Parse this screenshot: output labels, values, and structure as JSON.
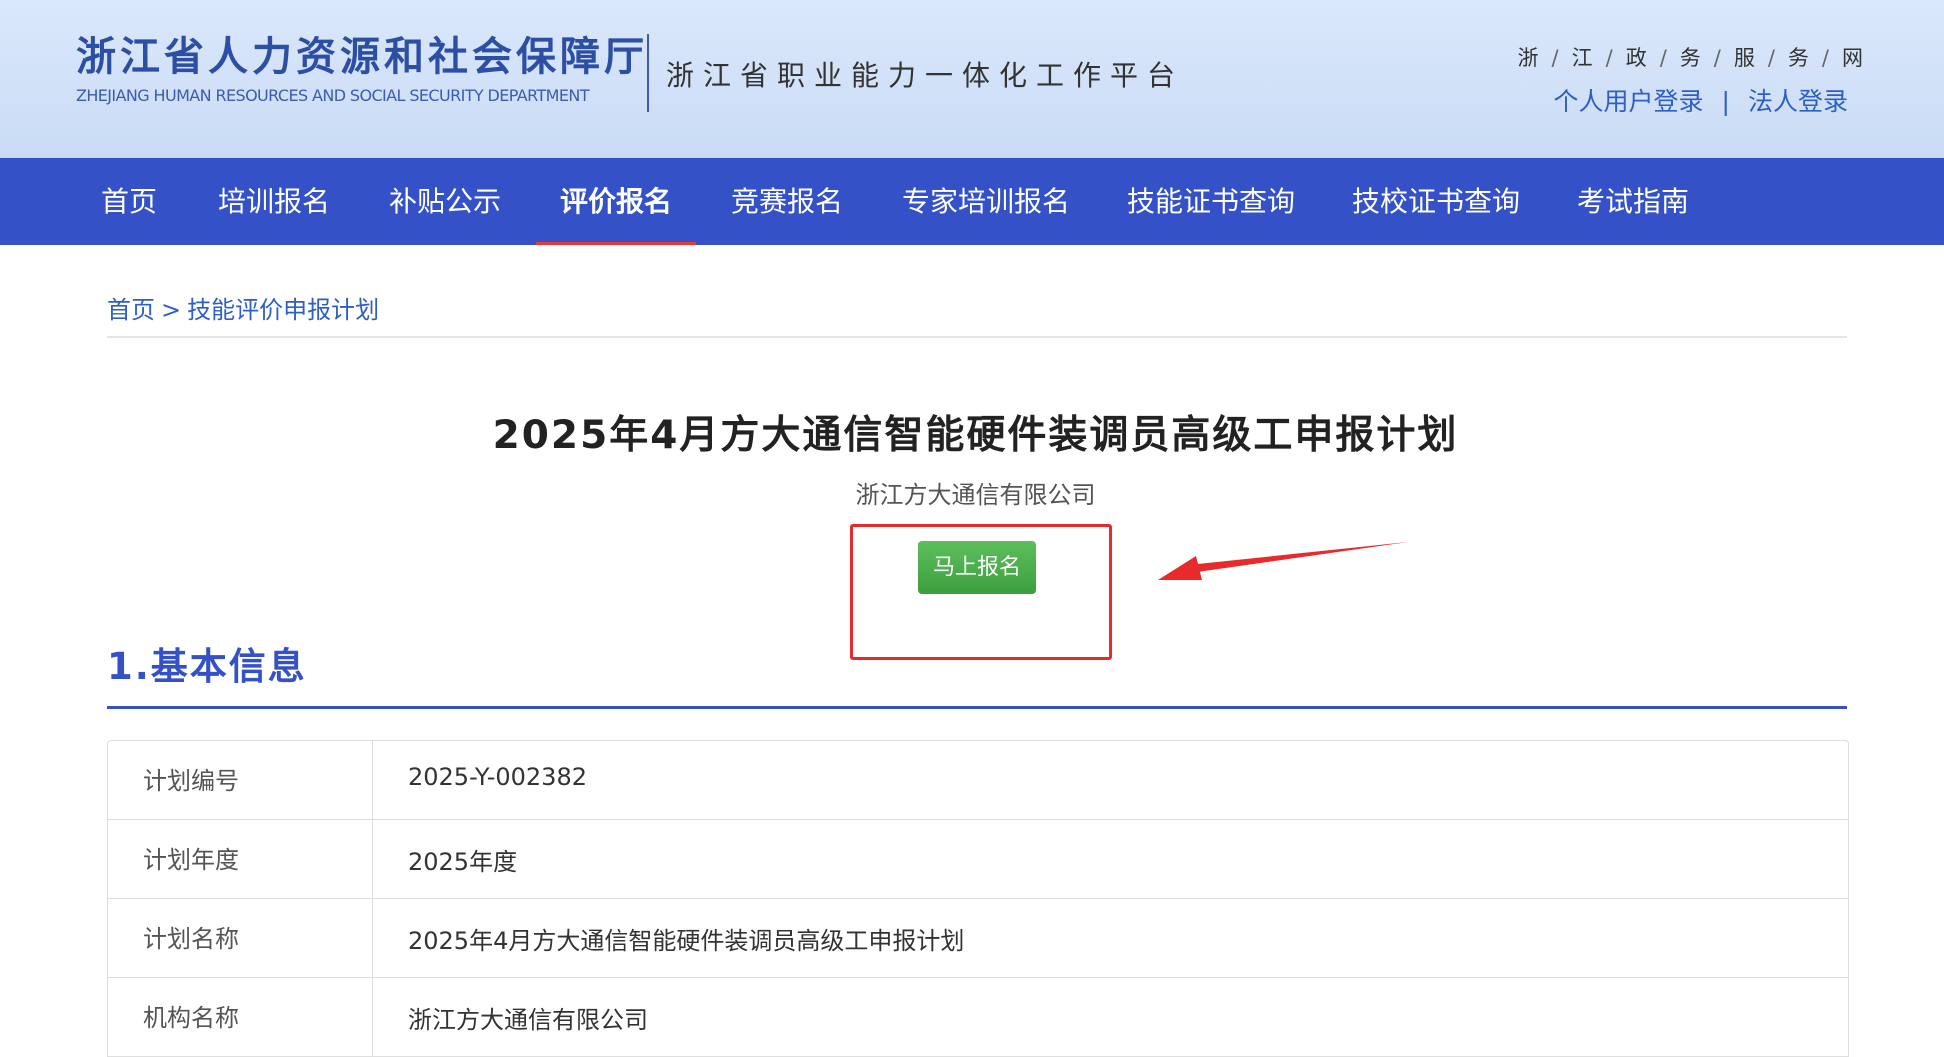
{
  "header": {
    "logo_cn": "浙江省人力资源和社会保障厅",
    "logo_en": "ZHEJIANG HUMAN RESOURCES AND SOCIAL SECURITY DEPARTMENT",
    "platform_name": "浙江省职业能力一体化工作平台",
    "gov_link_chars": [
      "浙",
      "江",
      "政",
      "务",
      "服",
      "务",
      "网"
    ],
    "personal_login": "个人用户登录",
    "corporate_login": "法人登录",
    "login_separator": "|"
  },
  "nav": {
    "items": [
      {
        "label": "首页",
        "active": false
      },
      {
        "label": "培训报名",
        "active": false
      },
      {
        "label": "补贴公示",
        "active": false
      },
      {
        "label": "评价报名",
        "active": true
      },
      {
        "label": "竞赛报名",
        "active": false
      },
      {
        "label": "专家培训报名",
        "active": false
      },
      {
        "label": "技能证书查询",
        "active": false
      },
      {
        "label": "技校证书查询",
        "active": false
      },
      {
        "label": "考试指南",
        "active": false
      }
    ]
  },
  "breadcrumb": {
    "home": "首页",
    "separator": ">",
    "current": "技能评价申报计划"
  },
  "plan": {
    "title": "2025年4月方大通信智能硬件装调员高级工申报计划",
    "organization": "浙江方大通信有限公司",
    "signup_label": "马上报名"
  },
  "section": {
    "title": "1.基本信息"
  },
  "info_rows": [
    {
      "key": "计划编号",
      "value": "2025-Y-002382"
    },
    {
      "key": "计划年度",
      "value": "2025年度"
    },
    {
      "key": "计划名称",
      "value": "2025年4月方大通信智能硬件装调员高级工申报计划"
    },
    {
      "key": "机构名称",
      "value": "浙江方大通信有限公司"
    }
  ],
  "colors": {
    "nav_bg": "#3451c8",
    "brand_blue": "#2c4ea5",
    "link_blue": "#2f5fc3",
    "active_underline": "#e53935",
    "button_green": "#4caf50",
    "annotation_red": "#e82a2a"
  }
}
